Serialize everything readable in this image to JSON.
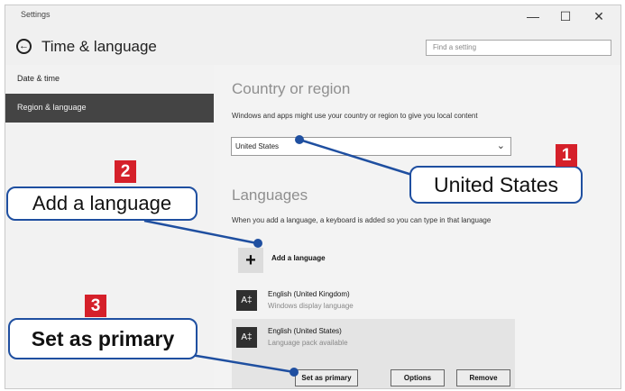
{
  "window": {
    "title": "Settings",
    "min_glyph": "—",
    "max_glyph": "☐",
    "close_glyph": "✕"
  },
  "header": {
    "back_glyph": "←",
    "title": "Time & language",
    "search_placeholder": "Find a setting"
  },
  "sidebar": {
    "items": [
      {
        "label": "Date & time"
      },
      {
        "label": "Region & language"
      }
    ]
  },
  "region": {
    "heading": "Country or region",
    "description": "Windows and apps might use your country or region to give you local content",
    "selected": "United States"
  },
  "languages": {
    "heading": "Languages",
    "description": "When you add a language, a keyboard is added so you can type in that language",
    "add_icon_glyph": "+",
    "add_label": "Add a language",
    "items": [
      {
        "icon_glyph": "A‡",
        "name": "English (United Kingdom)",
        "status": "Windows display language"
      },
      {
        "icon_glyph": "A‡",
        "name": "English (United States)",
        "status": "Language pack available"
      }
    ],
    "buttons": {
      "set_primary": "Set as primary",
      "options": "Options",
      "remove": "Remove"
    }
  },
  "callouts": [
    {
      "number": "1",
      "text": "United States"
    },
    {
      "number": "2",
      "text": "Add a language"
    },
    {
      "number": "3",
      "text": "Set as primary"
    }
  ],
  "colors": {
    "accent_red": "#d5202a",
    "callout_blue": "#1f4fa0",
    "sidebar_active": "#444444"
  }
}
